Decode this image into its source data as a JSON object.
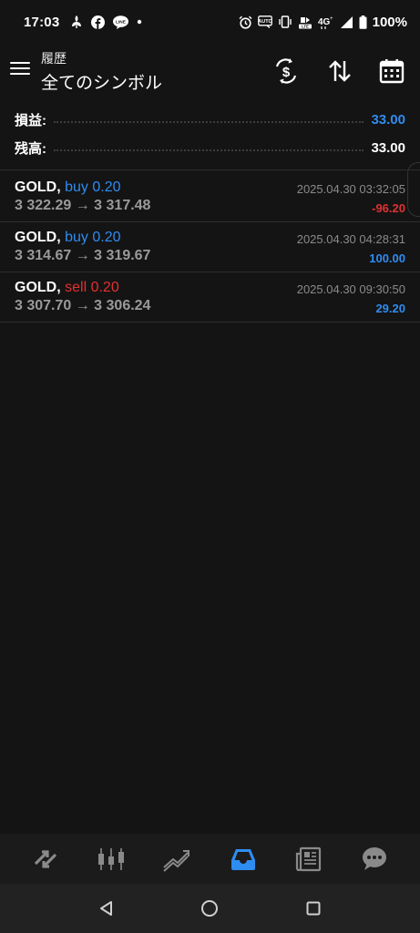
{
  "status_bar": {
    "time": "17:03",
    "left_icons": [
      "fan-icon",
      "facebook-icon",
      "line-icon",
      "dot-icon"
    ],
    "right_icons": [
      "alarm-icon",
      "auto-icon",
      "vibrate-icon",
      "volte-icon",
      "4g-icon",
      "signal-icon"
    ],
    "battery": "100%"
  },
  "app_bar": {
    "subtitle": "履歴",
    "title": "全てのシンボル",
    "actions": [
      "currency-exchange-icon",
      "sort-icon",
      "calendar-icon"
    ]
  },
  "summary": {
    "profit_label": "損益:",
    "profit_value": "33.00",
    "balance_label": "残高:",
    "balance_value": "33.00"
  },
  "trades": [
    {
      "symbol": "GOLD,",
      "side": "buy 0.20",
      "side_type": "buy",
      "prices": "3 322.29 → 3 317.48",
      "time": "2025.04.30 03:32:05",
      "profit": "-96.20",
      "profit_type": "neg"
    },
    {
      "symbol": "GOLD,",
      "side": "buy 0.20",
      "side_type": "buy",
      "prices": "3 314.67 → 3 319.67",
      "time": "2025.04.30 04:28:31",
      "profit": "100.00",
      "profit_type": "pos"
    },
    {
      "symbol": "GOLD,",
      "side": "sell 0.20",
      "side_type": "sell",
      "prices": "3 307.70 → 3 306.24",
      "time": "2025.04.30 09:30:50",
      "profit": "29.20",
      "profit_type": "pos"
    }
  ],
  "bottom_nav": {
    "items": [
      "quotes-icon",
      "chart-icon",
      "trade-icon",
      "history-icon",
      "news-icon",
      "chat-icon"
    ],
    "active": "history-icon"
  },
  "colors": {
    "accent_blue": "#2f8cf0",
    "loss_red": "#e33030",
    "background": "#141414"
  }
}
